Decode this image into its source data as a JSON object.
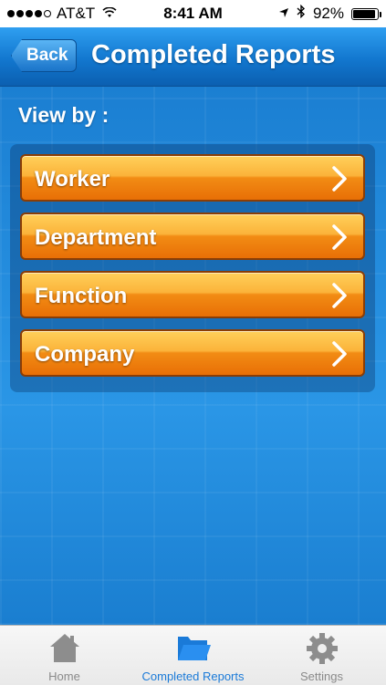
{
  "status_bar": {
    "carrier": "AT&T",
    "time": "8:41 AM",
    "battery": "92%",
    "battery_level": 0.92,
    "signal_bars": 4
  },
  "nav": {
    "back_label": "Back",
    "title": "Completed Reports"
  },
  "content": {
    "view_by_label": "View by :",
    "options": [
      {
        "label": "Worker"
      },
      {
        "label": "Department"
      },
      {
        "label": "Function"
      },
      {
        "label": "Company"
      }
    ]
  },
  "tab_bar": {
    "tabs": [
      {
        "label": "Home",
        "icon": "home-icon"
      },
      {
        "label": "Completed Reports",
        "icon": "folder-icon",
        "active": true
      },
      {
        "label": "Settings",
        "icon": "gear-icon"
      }
    ]
  },
  "colors": {
    "accent_blue": "#1a7ad8",
    "button_orange": "#f28c14",
    "background_blue": "#1f86d8"
  }
}
